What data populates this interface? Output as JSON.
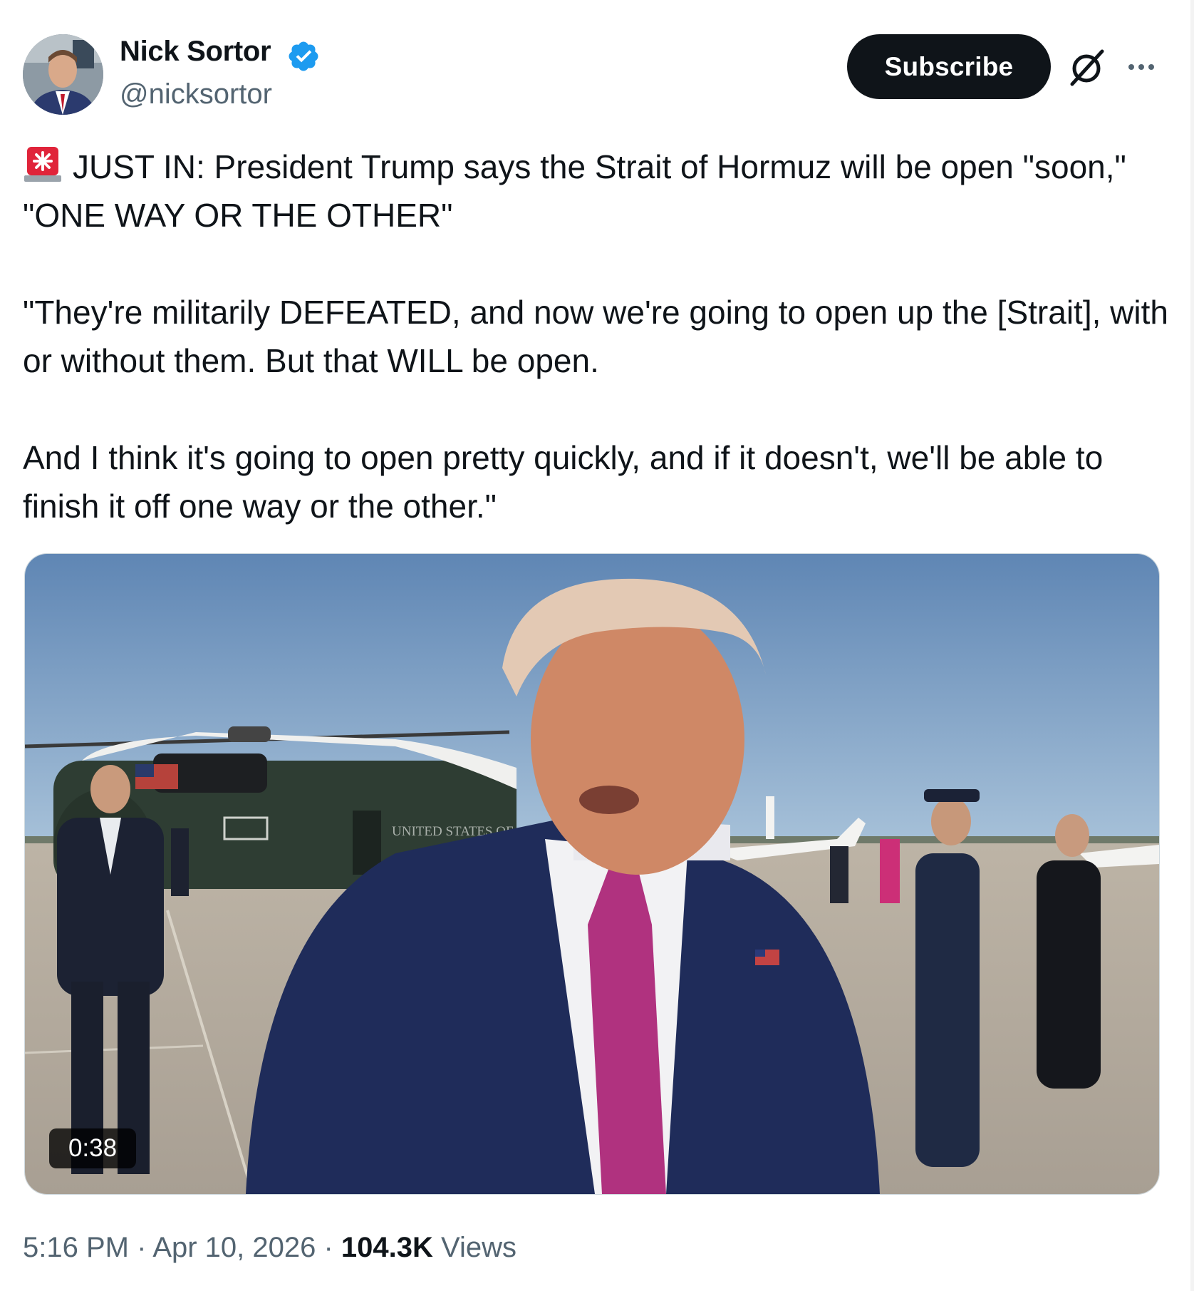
{
  "author": {
    "name": "Nick Sortor",
    "handle": "@nicksortor",
    "verified": true
  },
  "actions": {
    "subscribe_label": "Subscribe",
    "grok_icon": "grok-icon",
    "more_icon": "more-icon"
  },
  "tweet": {
    "line1": "JUST IN: President Trump says the Strait of Hormuz will be open \"soon,\" \"ONE WAY OR THE OTHER\"",
    "line2": "\"They're militarily DEFEATED, and now we're going to open up the [Strait], with or without them. But that WILL be open.",
    "line3": "And I think it's going to open pretty quickly, and if it doesn't, we'll be able to finish it off one way or the other.\"",
    "emoji": "rotating-light-icon"
  },
  "media": {
    "type": "video",
    "duration": "0:38"
  },
  "meta": {
    "time": "5:16 PM",
    "sep1": " · ",
    "date": "Apr 10, 2026",
    "sep2": " · ",
    "views_count": "104.3K",
    "views_label": " Views"
  },
  "colors": {
    "text": "#0f1419",
    "secondary": "#536471",
    "verified": "#1d9bf0",
    "button_bg": "#0f1419"
  }
}
